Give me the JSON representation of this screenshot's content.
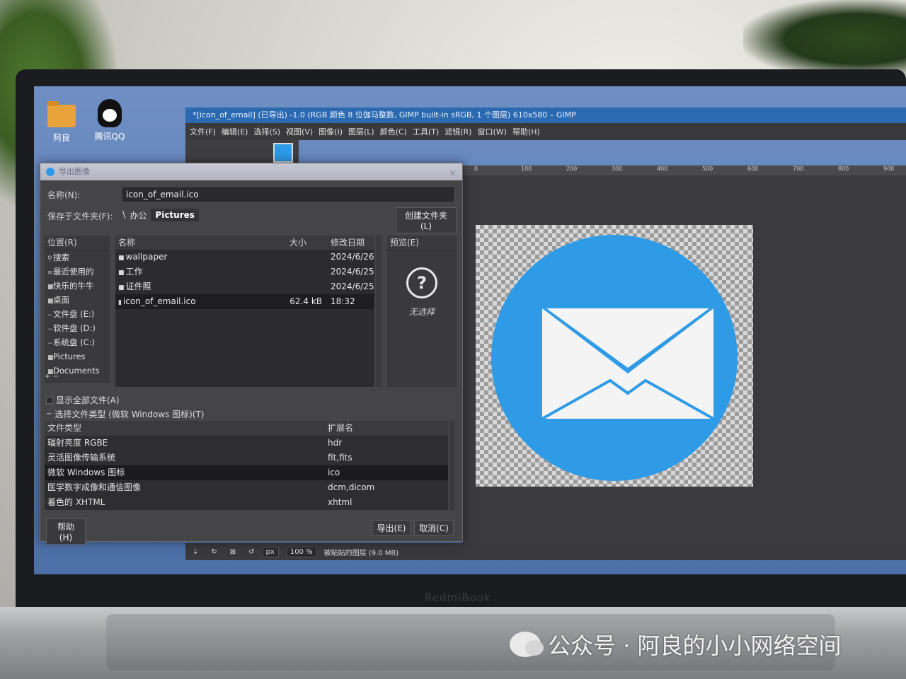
{
  "desktop": {
    "icons": [
      {
        "label": "阿良"
      },
      {
        "label": "腾讯QQ"
      }
    ]
  },
  "gimp": {
    "title": "*[icon_of_email] (已导出) -1.0 (RGB 颜色 8 位伽马整数, GIMP built-in sRGB, 1 个图层) 610x580 – GIMP",
    "menu": [
      "文件(F)",
      "编辑(E)",
      "选择(S)",
      "视图(V)",
      "图像(I)",
      "图层(L)",
      "颜色(C)",
      "工具(T)",
      "滤镜(R)",
      "窗口(W)",
      "帮助(H)"
    ],
    "ruler": [
      "0",
      "100",
      "200",
      "300",
      "400",
      "500",
      "600",
      "700",
      "800",
      "900"
    ],
    "status": {
      "unit": "px",
      "zoom": "100 %",
      "layer_info": "被粘贴的图层 (9.0 MB)"
    }
  },
  "dialog": {
    "title": "导出图像",
    "close_glyph": "×",
    "name_label": "名称(N):",
    "name_value": "icon_of_email.ico",
    "folder_label": "保存于文件夹(F):",
    "path": {
      "sep": "\\",
      "parent": "办公",
      "current": "Pictures"
    },
    "create_folder": "创建文件夹(L)",
    "places": {
      "header": "位置(R)",
      "items": [
        "搜索",
        "最近使用的",
        "快乐的牛牛",
        "桌面",
        "文件盘 (E:)",
        "软件盘 (D:)",
        "系统盘 (C:)",
        "Pictures",
        "Documents"
      ],
      "footer": "+ −"
    },
    "files": {
      "columns": {
        "name": "名称",
        "size": "大小",
        "date": "修改日期"
      },
      "rows": [
        {
          "name": "wallpaper",
          "size": "",
          "date": "2024/6/26"
        },
        {
          "name": "工作",
          "size": "",
          "date": "2024/6/25"
        },
        {
          "name": "证件照",
          "size": "",
          "date": "2024/6/25"
        },
        {
          "name": "icon_of_email.ico",
          "size": "62.4 kB",
          "date": "18:32"
        }
      ]
    },
    "preview": {
      "header": "预览(E)",
      "empty": "无选择"
    },
    "show_all": "显示全部文件(A)",
    "file_type_toggle": "选择文件类型 (微软 Windows 图标)(T)",
    "types": {
      "columns": {
        "name": "文件类型",
        "ext": "扩展名"
      },
      "rows": [
        {
          "name": "辐射亮度 RGBE",
          "ext": "hdr"
        },
        {
          "name": "灵活图像传输系统",
          "ext": "fit,fits"
        },
        {
          "name": "微软 Windows 图标",
          "ext": "ico"
        },
        {
          "name": "医学数字成像和通信图像",
          "ext": "dcm,dicom"
        },
        {
          "name": "着色的 XHTML",
          "ext": "xhtml"
        }
      ]
    },
    "buttons": {
      "help": "帮助(H)",
      "export": "导出(E)",
      "cancel": "取消(C)"
    }
  },
  "laptop": {
    "brand": "RedmiBook"
  },
  "watermark": "公众号 · 阿良的小小网络空间",
  "colors": {
    "accent": "#2f9be6",
    "titlebar": "#2b69b0",
    "dialog_bg": "#454548"
  }
}
